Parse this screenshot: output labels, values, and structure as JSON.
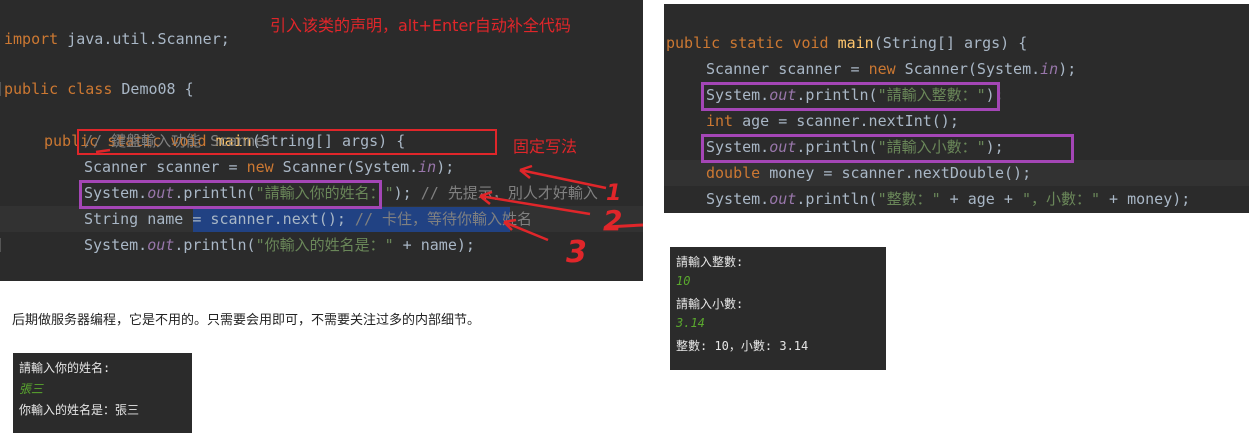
{
  "left_editor": {
    "header_import_kw": "import",
    "header_import_rest": " java.util.Scanner;",
    "header_note": "引入该类的声明，alt+Enter自动补全代码",
    "class_kw": "public class",
    "class_rest": " Demo08 {",
    "main_kw1": "public static void",
    "main_name": "main",
    "main_rest": "(String[] args) {",
    "comment_line": "// 鍵盤輸入功能 Scanner",
    "scanner_a": "Scanner scanner = ",
    "scanner_new": "new",
    "scanner_b": " Scanner(System.",
    "scanner_in": "in",
    "scanner_c": ");",
    "fixed_note": "固定写法",
    "println1_a": "System.",
    "println1_out": "out",
    "println1_b": ".println(",
    "println1_str": "\"請輸入你的姓名：\"",
    "println1_c": "); ",
    "println1_cmt": "// 先提示，別人才好輸入",
    "next_line": "String name = scanner.next();",
    "next_cmt": " // 卡住，等待你輸入姓名",
    "println2_a": "System.",
    "println2_out": "out",
    "println2_b": ".println(",
    "println2_str": "\"你輸入的姓名是：\"",
    "println2_c": " + name);",
    "close1": "}",
    "close2": "}",
    "hand1": "1",
    "hand2": "2",
    "hand3": "3"
  },
  "caption": "后期做服务器编程，它是不用的。只需要会用即可，不需要关注过多的内部细节。",
  "console_left": {
    "prompt": "請輸入你的姓名:",
    "input": "張三",
    "result": "你輸入的姓名是：張三"
  },
  "right_editor": {
    "l1_kw": "public static void",
    "l1_fn": "main",
    "l1_rest": "(String[] args) {",
    "l2_a": "Scanner scanner = ",
    "l2_new": "new",
    "l2_b": " Scanner(System.",
    "l2_in": "in",
    "l2_c": ");",
    "l3_a": "System.",
    "l3_out": "out",
    "l3_b": ".println(",
    "l3_str": "\"請輸入整數：\"",
    "l3_c": ");",
    "l4_kw": "int",
    "l4_rest": " age = scanner.nextInt();",
    "l5_a": "System.",
    "l5_out": "out",
    "l5_b": ".println(",
    "l5_str": "\"請輸入小數：\"",
    "l5_c": ");",
    "l6_kw": "double",
    "l6_rest": " money = scanner.nextDouble();",
    "l7_a": "System.",
    "l7_out": "out",
    "l7_b": ".println(",
    "l7_str1": "\"整數：\"",
    "l7_mid": " + age + ",
    "l7_str2": "\"，小數：\"",
    "l7_c": " + money);",
    "close": "}"
  },
  "console_right": {
    "prompt1": "請輸入整數:",
    "input1": "10",
    "prompt2": "請輸入小數:",
    "input2": "3.14",
    "result": "整數: 10，小數: 3.14"
  },
  "colors": {
    "editor_bg": "#2b2b2b",
    "keyword": "#cc7832",
    "method": "#ffc66d",
    "string": "#6a8759",
    "field": "#9876aa",
    "comment": "#808080",
    "annotation_red": "#e0262a",
    "box_purple": "#a446b6",
    "selection": "#214283",
    "console_input": "#5aa82e"
  }
}
